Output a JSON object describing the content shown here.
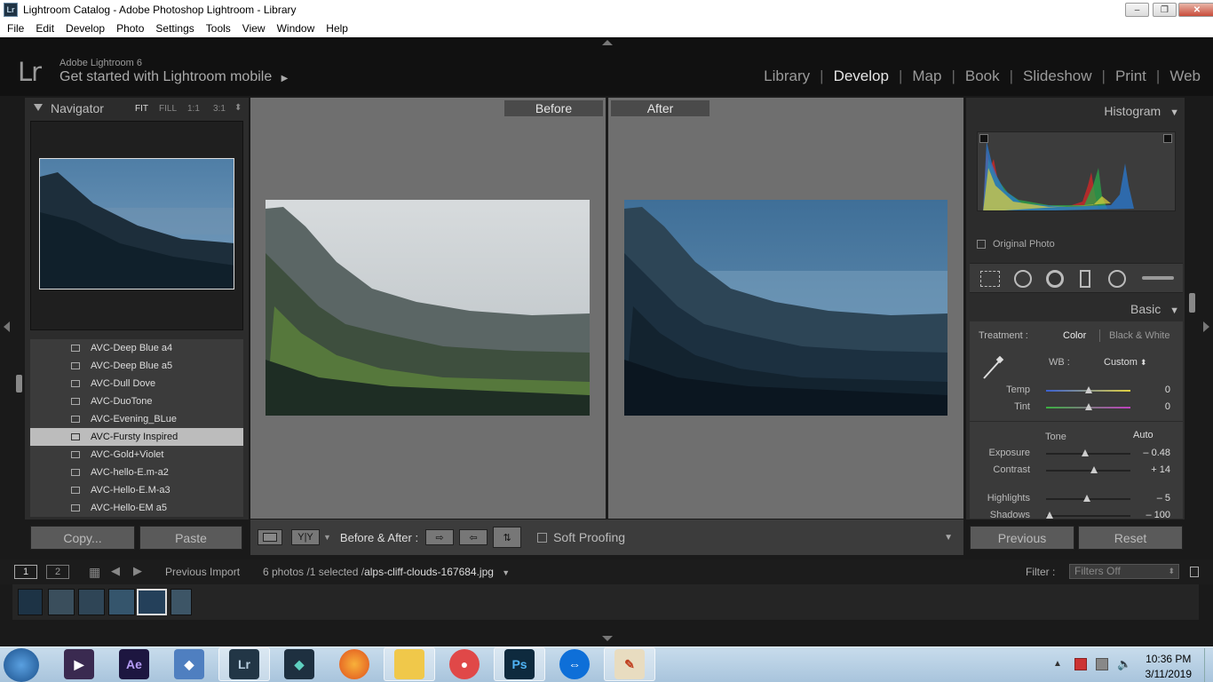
{
  "window": {
    "title": "Lightroom Catalog - Adobe Photoshop Lightroom - Library",
    "icon_label": "Lr",
    "min_glyph": "–",
    "max_glyph": "❐",
    "close_glyph": "✕"
  },
  "menu": [
    "File",
    "Edit",
    "Develop",
    "Photo",
    "Settings",
    "Tools",
    "View",
    "Window",
    "Help"
  ],
  "identity": {
    "logo": "Lr",
    "version": "Adobe Lightroom 6",
    "mobile": "Get started with Lightroom mobile",
    "mobile_arrow": "▶"
  },
  "modules": [
    "Library",
    "Develop",
    "Map",
    "Book",
    "Slideshow",
    "Print",
    "Web"
  ],
  "active_module": "Develop",
  "navigator": {
    "title": "Navigator",
    "zoom": [
      "FIT",
      "FILL",
      "1:1",
      "3:1"
    ],
    "zoom_stepper": "⬍"
  },
  "presets": [
    {
      "label": "AVC-Deep Blue a4",
      "selected": false
    },
    {
      "label": "AVC-Deep Blue a5",
      "selected": false
    },
    {
      "label": "AVC-Dull Dove",
      "selected": false
    },
    {
      "label": "AVC-DuoTone",
      "selected": false
    },
    {
      "label": "AVC-Evening_BLue",
      "selected": false
    },
    {
      "label": "AVC-Fursty Inspired",
      "selected": true
    },
    {
      "label": "AVC-Gold+Violet",
      "selected": false
    },
    {
      "label": "AVC-hello-E.m-a2",
      "selected": false
    },
    {
      "label": "AVC-Hello-E.M-a3",
      "selected": false
    },
    {
      "label": "AVC-Hello-EM a5",
      "selected": false
    }
  ],
  "left_buttons": {
    "copy": "Copy...",
    "paste": "Paste"
  },
  "view": {
    "before": "Before",
    "after": "After"
  },
  "toolbar": {
    "yy": "Y|Y",
    "before_after_label": "Before & After :",
    "soft_proofing": "Soft Proofing"
  },
  "histogram": {
    "title": "Histogram",
    "original_photo": "Original Photo"
  },
  "basic": {
    "title": "Basic",
    "treatment_label": "Treatment :",
    "color": "Color",
    "bw": "Black & White",
    "wb_label": "WB :",
    "wb_value": "Custom",
    "wb_stepper": "⬍",
    "tone_label": "Tone",
    "auto": "Auto",
    "sliders": [
      {
        "label": "Temp",
        "value": "0",
        "pos": 0.5
      },
      {
        "label": "Tint",
        "value": "0",
        "pos": 0.5
      },
      {
        "label": "Exposure",
        "value": "– 0.48",
        "pos": 0.46
      },
      {
        "label": "Contrast",
        "value": "+ 14",
        "pos": 0.57
      },
      {
        "label": "Highlights",
        "value": "– 5",
        "pos": 0.48
      },
      {
        "label": "Shadows",
        "value": "– 100",
        "pos": 0.04
      }
    ]
  },
  "right_buttons": {
    "previous": "Previous",
    "reset": "Reset"
  },
  "filmbar": {
    "page1": "1",
    "page2": "2",
    "source": "Previous Import",
    "count": "6 photos /1 selected /",
    "filename": "alps-cliff-clouds-167684.jpg",
    "filter_label": "Filter :",
    "filter_value": "Filters Off"
  },
  "taskbar": {
    "time": "10:36 PM",
    "date": "3/11/2019",
    "apps": [
      "windows-media-player",
      "after-effects",
      "app-diamond",
      "lightroom",
      "filmora",
      "firefox",
      "file-explorer",
      "screen-recorder",
      "photoshop",
      "teamviewer",
      "paint"
    ]
  },
  "colors": {
    "accent": "#e6e6e6",
    "panel": "#3a3a3a",
    "center": "#6f6f6f"
  }
}
